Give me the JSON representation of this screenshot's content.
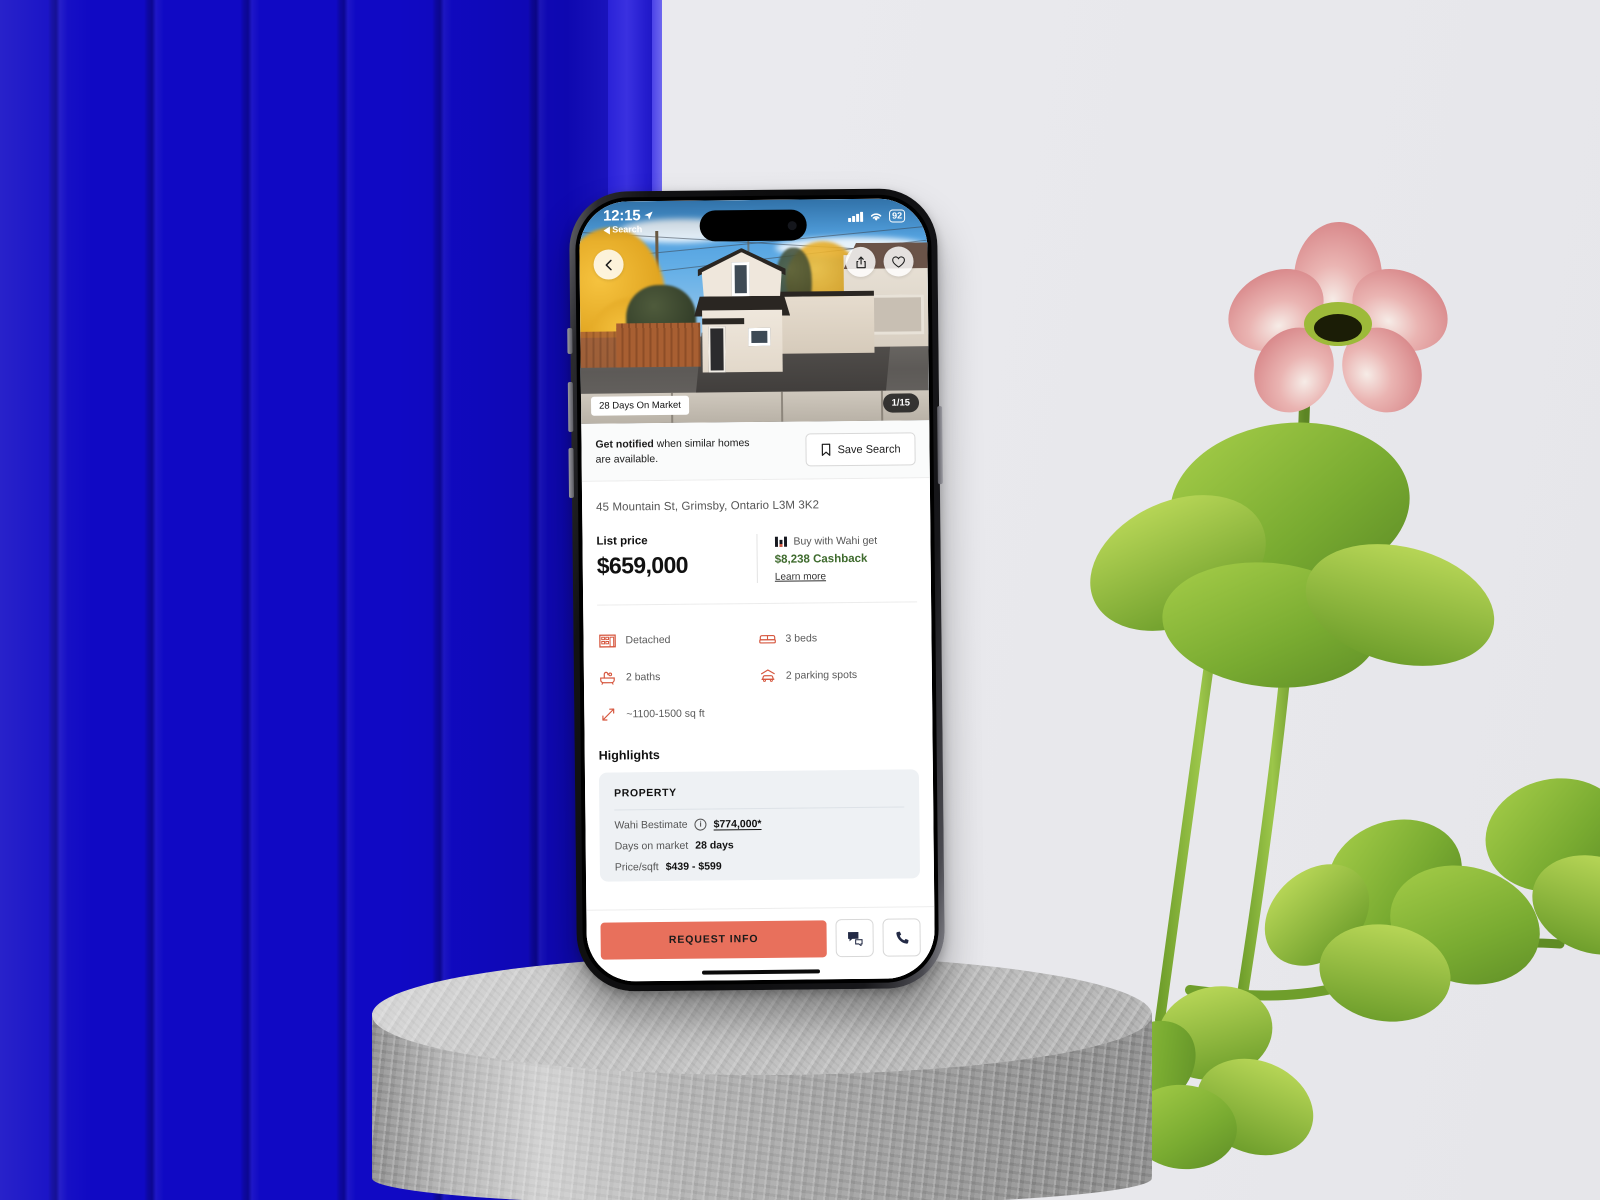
{
  "scene": {
    "background_blue": "#1009c4",
    "background_grey": "#e8e8ec",
    "podium_color": "#b5b5b5",
    "plant_green": "#8fbf3e",
    "flower_pink": "#e39aa0"
  },
  "phone": {
    "status_bar": {
      "time": "12:15",
      "back_app_label": "Search",
      "location_icon": "location-arrow-icon",
      "cellular_icon": "cellular-signal-icon",
      "wifi_icon": "wifi-icon",
      "battery_level": "92"
    },
    "home_indicator": "home-indicator"
  },
  "hero": {
    "back_icon": "chevron-left-icon",
    "share_icon": "share-icon",
    "favorite_icon": "heart-icon",
    "days_badge": "28 Days On Market",
    "photo_counter": "1/15",
    "photo_alt": "exterior-front-of-house"
  },
  "notify": {
    "bold_text": "Get notified",
    "rest_text": " when similar homes are available.",
    "save_icon": "bookmark-icon",
    "save_label": "Save Search"
  },
  "listing": {
    "address": "45 Mountain St, Grimsby, Ontario L3M 3K2",
    "price_label": "List price",
    "price_value": "$659,000",
    "cashback": {
      "brand_icon": "wahi-logo-icon",
      "lead_text": "Buy with Wahi get",
      "amount": "$8,238",
      "amount_suffix": " Cashback",
      "learn_more": "Learn more"
    },
    "features": [
      {
        "icon": "building-detached-icon",
        "label": "Detached"
      },
      {
        "icon": "bed-icon",
        "label": "3 beds"
      },
      {
        "icon": "bathtub-icon",
        "label": "2 baths"
      },
      {
        "icon": "car-parking-icon",
        "label": "2 parking spots"
      },
      {
        "icon": "area-arrows-icon",
        "label": "~1100-1500 sq ft"
      }
    ]
  },
  "highlights": {
    "title": "Highlights",
    "section_header": "PROPERTY",
    "rows": [
      {
        "label": "Wahi Bestimate",
        "info_icon": "info-icon",
        "value": "$774,000*",
        "underlined": true
      },
      {
        "label": "Days on market",
        "value": "28 days",
        "underlined": false
      },
      {
        "label": "Price/sqft",
        "value": "$439 - $599",
        "underlined": false
      }
    ]
  },
  "bottom_bar": {
    "request_label": "REQUEST INFO",
    "chat_icon": "chat-bubbles-icon",
    "phone_icon": "phone-icon"
  }
}
